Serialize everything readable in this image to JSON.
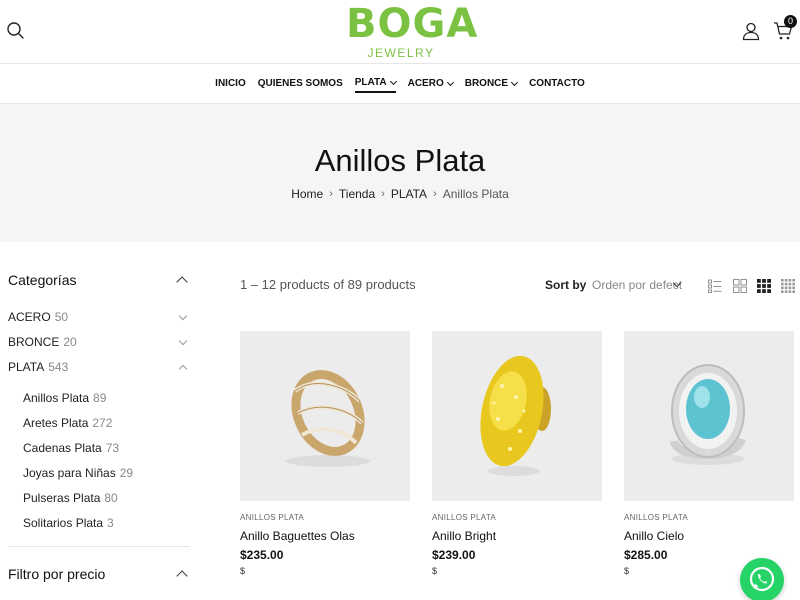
{
  "header": {
    "logo_text": "BOGA",
    "logo_subtext": "JEWELRY",
    "cart_count": "0",
    "brand_color": "#7cc242"
  },
  "nav": {
    "items": [
      {
        "label": "INICIO",
        "dropdown": false,
        "active": false
      },
      {
        "label": "QUIENES SOMOS",
        "dropdown": false,
        "active": false
      },
      {
        "label": "PLATA",
        "dropdown": true,
        "active": true
      },
      {
        "label": "ACERO",
        "dropdown": true,
        "active": false
      },
      {
        "label": "BRONCE",
        "dropdown": true,
        "active": false
      },
      {
        "label": "CONTACTO",
        "dropdown": false,
        "active": false
      }
    ]
  },
  "banner": {
    "title": "Anillos Plata",
    "breadcrumb": [
      "Home",
      "Tienda",
      "PLATA",
      "Anillos Plata"
    ]
  },
  "sidebar": {
    "categories_title": "Categorías",
    "categories": [
      {
        "label": "ACERO",
        "count": "50",
        "expanded": false
      },
      {
        "label": "BRONCE",
        "count": "20",
        "expanded": false
      },
      {
        "label": "PLATA",
        "count": "543",
        "expanded": true
      }
    ],
    "subcategories": [
      {
        "label": "Anillos Plata",
        "count": "89"
      },
      {
        "label": "Aretes Plata",
        "count": "272"
      },
      {
        "label": "Cadenas Plata",
        "count": "73"
      },
      {
        "label": "Joyas para Niñas",
        "count": "29"
      },
      {
        "label": "Pulseras Plata",
        "count": "80"
      },
      {
        "label": "Solitarios Plata",
        "count": "3"
      }
    ],
    "price_filter_title": "Filtro por precio"
  },
  "toolbar": {
    "result_count": "1 – 12 products of 89 products",
    "sort_label": "Sort by",
    "sort_value": "Orden por defecto",
    "view_icons": [
      "list-view-icon",
      "grid-2-icon",
      "grid-3-icon",
      "grid-4-icon"
    ]
  },
  "products": [
    {
      "category": "ANILLOS PLATA",
      "name": "Anillo Baguettes Olas",
      "price": "$235.00",
      "currency": "$"
    },
    {
      "category": "ANILLOS PLATA",
      "name": "Anillo Bright",
      "price": "$239.00",
      "currency": "$"
    },
    {
      "category": "ANILLOS PLATA",
      "name": "Anillo Cielo",
      "price": "$285.00",
      "currency": "$"
    }
  ]
}
